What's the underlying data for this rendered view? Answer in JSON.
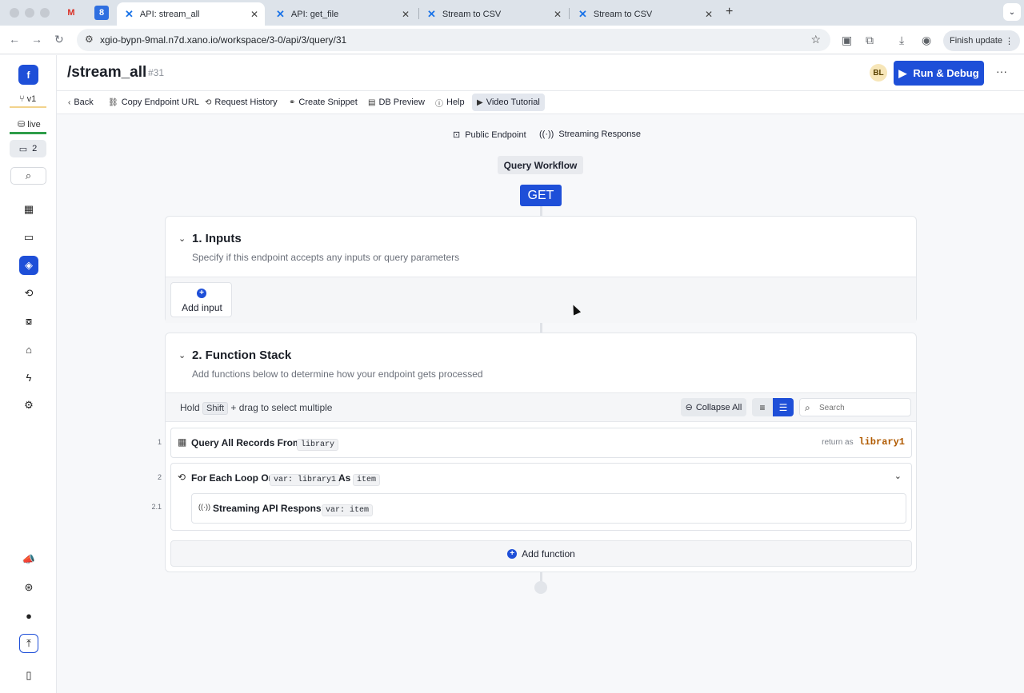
{
  "browser": {
    "tabs": [
      {
        "title": "API: stream_all",
        "active": true
      },
      {
        "title": "API: get_file",
        "active": false
      },
      {
        "title": "Stream to CSV",
        "active": false
      },
      {
        "title": "Stream to CSV",
        "active": false
      }
    ],
    "url": "xgio-bypn-9mal.n7d.xano.io/workspace/3-0/api/3/query/31",
    "finish_update": "Finish update"
  },
  "sidebar": {
    "workspace_initial": "f",
    "branch": "v1",
    "live": "live",
    "comments_count": "2",
    "nav_icons": [
      "dashboard-icon",
      "database-icon",
      "api-layers-icon",
      "history-icon",
      "library-icon",
      "marketplace-icon",
      "tasks-bolt-icon",
      "settings-icon"
    ],
    "bottom_icons": [
      "announcements-icon",
      "support-icon",
      "user-icon",
      "upload-icon",
      "panel-icon"
    ]
  },
  "header": {
    "title": "/stream_all",
    "id": "#31",
    "avatar": "BL",
    "run_label": "Run & Debug",
    "more": "···"
  },
  "actions": [
    {
      "label": "Back",
      "icon": "‹"
    },
    {
      "label": "Copy Endpoint URL",
      "icon": "⛓"
    },
    {
      "label": "Request History",
      "icon": "⟲"
    },
    {
      "label": "Create Snippet",
      "icon": "⚭"
    },
    {
      "label": "DB Preview",
      "icon": "▤"
    },
    {
      "label": "Help",
      "icon": "ⓘ"
    },
    {
      "label": "Video Tutorial",
      "icon": "▶"
    }
  ],
  "canvas": {
    "public_endpoint": "Public Endpoint",
    "streaming_response": "Streaming Response",
    "workflow_label": "Query Workflow",
    "method": "GET"
  },
  "inputs": {
    "title": "1. Inputs",
    "subtitle": "Specify if this endpoint accepts any inputs or query parameters",
    "add_input": "Add input"
  },
  "function_stack": {
    "title": "2. Function Stack",
    "subtitle": "Add functions below to determine how your endpoint gets processed",
    "hint_hold": "Hold",
    "hint_key": "Shift",
    "hint_rest": "+ drag to select multiple",
    "collapse_all": "Collapse All",
    "search_placeholder": "Search",
    "steps": [
      {
        "num": "1",
        "title": "Query All Records From",
        "chip": "library",
        "return_label": "return as",
        "return_var": "library1"
      },
      {
        "num": "2",
        "title": "For Each Loop On",
        "chip_prefix": "var:",
        "chip": "library1",
        "as_label": "As",
        "as_chip": "item"
      },
      {
        "num": "2.1",
        "title": "Streaming API Response",
        "chip_prefix": "var:",
        "chip": "item"
      }
    ],
    "add_function": "Add function"
  },
  "colors": {
    "accent": "#1e4fd8",
    "live": "#2e9d49",
    "return_var": "#b05a00"
  }
}
